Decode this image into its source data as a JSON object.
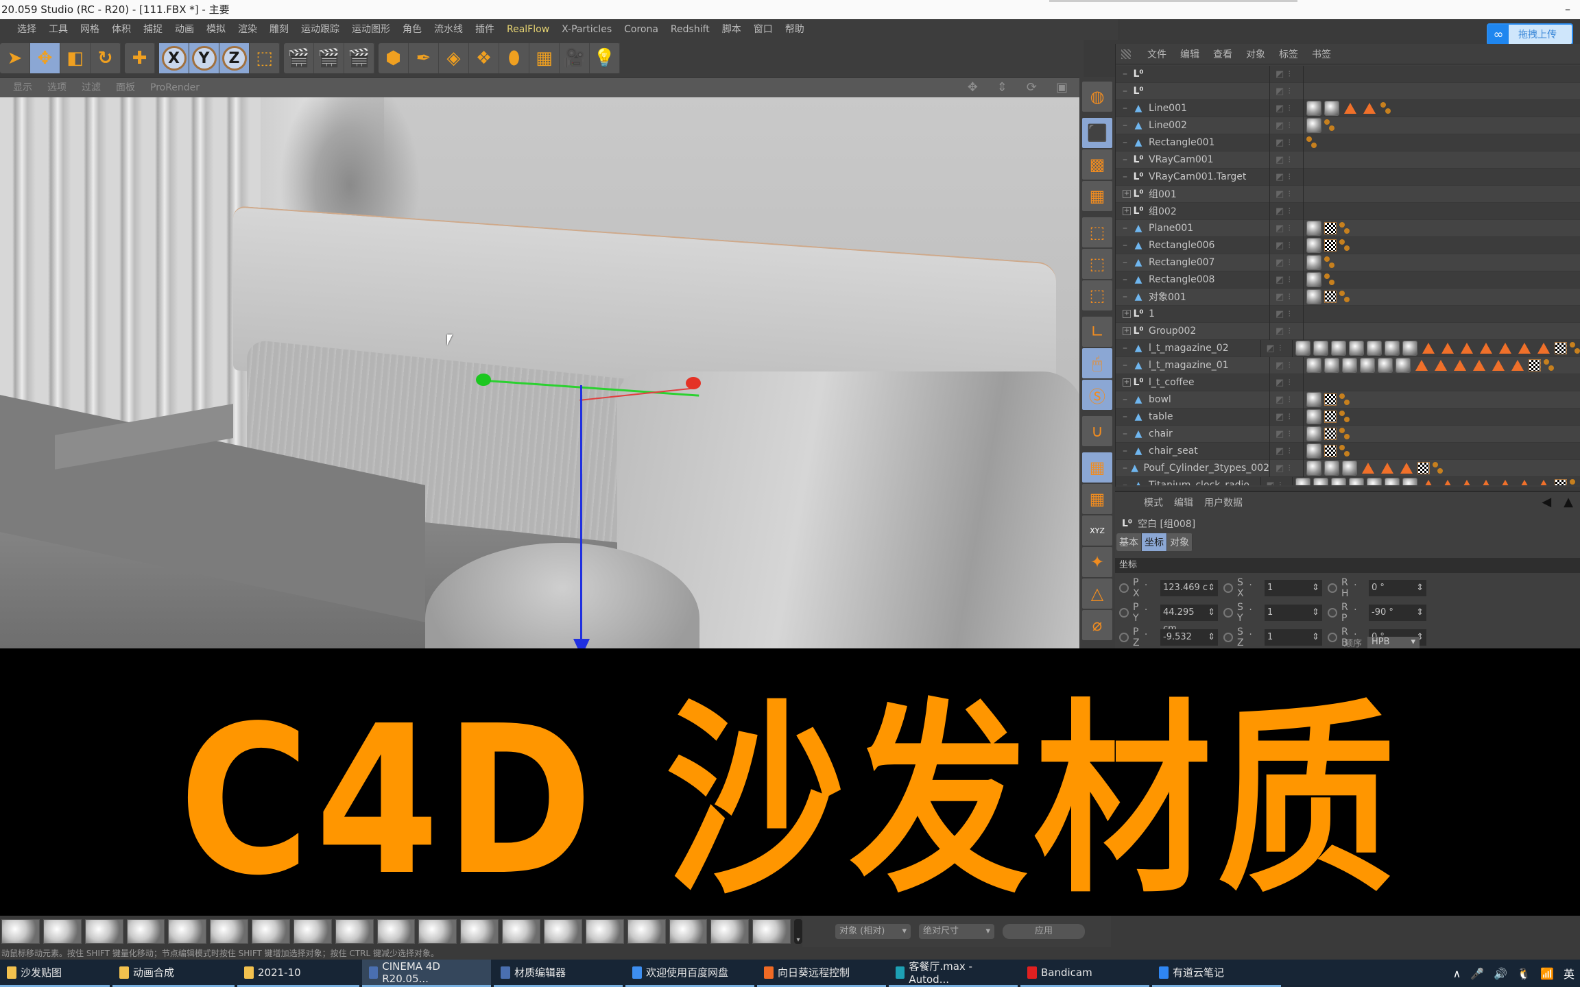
{
  "window": {
    "title": "20.059 Studio (RC - R20) - [111.FBX *] - 主要",
    "minimize_icon": "–"
  },
  "menubar": {
    "items": [
      "选择",
      "工具",
      "网格",
      "体积",
      "捕捉",
      "动画",
      "模拟",
      "渲染",
      "雕刻",
      "运动跟踪",
      "运动图形",
      "角色",
      "流水线",
      "插件",
      "RealFlow",
      "X-Particles",
      "Corona",
      "Redshift",
      "脚本",
      "窗口",
      "帮助"
    ],
    "highlight": "RealFlow"
  },
  "upload_widget": {
    "label": "拖拽上传",
    "icon": "baidu-cloud-icon"
  },
  "toolbar": {
    "groups": [
      [
        {
          "icon": "select-arrow-icon",
          "glyph": "➤",
          "on": false
        },
        {
          "icon": "move-icon",
          "glyph": "✥",
          "on": true
        },
        {
          "icon": "scale-icon",
          "glyph": "◧",
          "on": false
        },
        {
          "icon": "rotate-icon",
          "glyph": "↻",
          "on": false
        }
      ],
      [
        {
          "icon": "live-selection-icon",
          "glyph": "✚",
          "on": false
        }
      ],
      [
        {
          "icon": "x-axis-lock-icon",
          "glyph": "X",
          "on": true,
          "circle": true
        },
        {
          "icon": "y-axis-lock-icon",
          "glyph": "Y",
          "on": true,
          "circle": true
        },
        {
          "icon": "z-axis-lock-icon",
          "glyph": "Z",
          "on": true,
          "circle": true
        },
        {
          "icon": "coordinate-system-icon",
          "glyph": "⬚",
          "on": false
        }
      ],
      [
        {
          "icon": "render-view-icon",
          "glyph": "🎬",
          "on": false
        },
        {
          "icon": "render-picture-viewer-icon",
          "glyph": "🎬",
          "on": false
        },
        {
          "icon": "render-settings-icon",
          "glyph": "🎬",
          "on": false
        }
      ],
      [
        {
          "icon": "cube-icon",
          "glyph": "⬢",
          "on": false
        },
        {
          "icon": "pen-spline-icon",
          "glyph": "✒",
          "on": false
        },
        {
          "icon": "subdivision-icon",
          "glyph": "◈",
          "on": false
        },
        {
          "icon": "cloner-icon",
          "glyph": "❖",
          "on": false
        },
        {
          "icon": "deformer-icon",
          "glyph": "⬮",
          "on": false
        },
        {
          "icon": "floor-icon",
          "glyph": "▦",
          "on": false
        },
        {
          "icon": "camera-icon",
          "glyph": "🎥",
          "on": false
        },
        {
          "icon": "light-icon",
          "glyph": "💡",
          "on": false
        }
      ]
    ]
  },
  "viewport": {
    "menu": [
      "显示",
      "选项",
      "过滤",
      "面板",
      "ProRender"
    ],
    "nav_icons": [
      {
        "icon": "pan-icon",
        "glyph": "✥"
      },
      {
        "icon": "dolly-icon",
        "glyph": "⇕"
      },
      {
        "icon": "orbit-icon",
        "glyph": "⟳"
      },
      {
        "icon": "maximize-view-icon",
        "glyph": "▣"
      }
    ]
  },
  "side_tools": [
    {
      "icon": "make-editable-icon",
      "glyph": "◍",
      "on": false
    },
    {
      "icon": "model-mode-icon",
      "glyph": "⬛",
      "on": true,
      "gap": true
    },
    {
      "icon": "texture-mode-icon",
      "glyph": "▩",
      "on": false
    },
    {
      "icon": "workplane-mode-icon",
      "glyph": "▦",
      "on": false
    },
    {
      "icon": "points-mode-icon",
      "glyph": "⬚",
      "on": false,
      "gap": true
    },
    {
      "icon": "edges-mode-icon",
      "glyph": "⬚",
      "on": false
    },
    {
      "icon": "polygons-mode-icon",
      "glyph": "⬚",
      "on": false
    },
    {
      "icon": "axis-mode-icon",
      "glyph": "∟",
      "on": false,
      "gap": true
    },
    {
      "icon": "tweak-mode-icon",
      "glyph": "🖱",
      "on": true
    },
    {
      "icon": "solo-icon",
      "glyph": "Ⓢ",
      "on": true
    },
    {
      "icon": "snap-icon",
      "glyph": "∪",
      "on": false,
      "gap": true
    },
    {
      "icon": "workplane-lock-icon",
      "glyph": "▦",
      "on": true,
      "gap": true
    },
    {
      "icon": "workplane-align-icon",
      "glyph": "▦",
      "on": false
    },
    {
      "icon": "locked-axes-icon",
      "glyph": "XYZ",
      "on": false
    },
    {
      "icon": "center-axis-icon",
      "glyph": "✦",
      "on": false
    },
    {
      "icon": "symmetry-icon",
      "glyph": "△",
      "on": false
    },
    {
      "icon": "sculpt-icon",
      "glyph": "⌀",
      "on": false
    }
  ],
  "object_manager": {
    "menu": [
      "文件",
      "编辑",
      "查看",
      "对象",
      "标签",
      "书签"
    ],
    "rows": [
      {
        "name": "",
        "type": "null",
        "expand": false,
        "tags": []
      },
      {
        "name": "",
        "type": "null",
        "expand": false,
        "tags": []
      },
      {
        "name": "Line001",
        "type": "poly",
        "expand": false,
        "tags": [
          "mat",
          "mat",
          "tri",
          "tri",
          "uv"
        ]
      },
      {
        "name": "Line002",
        "type": "poly",
        "expand": false,
        "tags": [
          "mat",
          "uv"
        ]
      },
      {
        "name": "Rectangle001",
        "type": "poly",
        "expand": false,
        "tags": [
          "uv"
        ]
      },
      {
        "name": "VRayCam001",
        "type": "null",
        "expand": false,
        "tags": []
      },
      {
        "name": "VRayCam001.Target",
        "type": "null",
        "expand": false,
        "tags": []
      },
      {
        "name": "组001",
        "type": "null",
        "expand": true,
        "tags": []
      },
      {
        "name": "组002",
        "type": "null",
        "expand": true,
        "tags": []
      },
      {
        "name": "Plane001",
        "type": "poly",
        "expand": false,
        "tags": [
          "mat",
          "chk",
          "uv"
        ]
      },
      {
        "name": "Rectangle006",
        "type": "poly",
        "expand": false,
        "tags": [
          "mat",
          "chk",
          "uv"
        ]
      },
      {
        "name": "Rectangle007",
        "type": "poly",
        "expand": false,
        "tags": [
          "mat",
          "uv"
        ]
      },
      {
        "name": "Rectangle008",
        "type": "poly",
        "expand": false,
        "tags": [
          "mat",
          "uv"
        ]
      },
      {
        "name": "对象001",
        "type": "poly",
        "expand": false,
        "tags": [
          "mat",
          "chk",
          "uv"
        ]
      },
      {
        "name": "1",
        "type": "null",
        "expand": true,
        "tags": []
      },
      {
        "name": "Group002",
        "type": "null",
        "expand": true,
        "tags": []
      },
      {
        "name": "l_t_magazine_02",
        "type": "poly",
        "expand": false,
        "tags": [
          "mat",
          "mat",
          "mat",
          "mat",
          "mat",
          "mat",
          "mat",
          "tri",
          "tri",
          "tri",
          "tri",
          "tri",
          "tri",
          "tri",
          "chk",
          "uv"
        ]
      },
      {
        "name": "l_t_magazine_01",
        "type": "poly",
        "expand": false,
        "tags": [
          "mat",
          "mat",
          "mat",
          "mat",
          "mat",
          "mat",
          "tri",
          "tri",
          "tri",
          "tri",
          "tri",
          "tri",
          "chk",
          "uv"
        ]
      },
      {
        "name": "l_t_coffee",
        "type": "null",
        "expand": true,
        "tags": []
      },
      {
        "name": "bowl",
        "type": "poly",
        "expand": false,
        "tags": [
          "mat",
          "chk",
          "uv"
        ]
      },
      {
        "name": "table",
        "type": "poly",
        "expand": false,
        "tags": [
          "mat",
          "chk",
          "uv"
        ]
      },
      {
        "name": "chair",
        "type": "poly",
        "expand": false,
        "tags": [
          "mat",
          "chk",
          "uv"
        ]
      },
      {
        "name": "chair_seat",
        "type": "poly",
        "expand": false,
        "tags": [
          "mat",
          "chk",
          "uv"
        ]
      },
      {
        "name": "Pouf_Cylinder_3types_002",
        "type": "poly",
        "expand": false,
        "tags": [
          "mat",
          "mat",
          "mat",
          "tri",
          "tri",
          "tri",
          "chk",
          "uv"
        ]
      },
      {
        "name": "Titanium_clock_radio",
        "type": "poly",
        "expand": false,
        "tags": [
          "mat",
          "mat",
          "mat",
          "mat",
          "mat",
          "mat",
          "mat",
          "tri",
          "tri",
          "tri",
          "tri",
          "tri",
          "tri",
          "tri",
          "chk",
          "uv"
        ]
      }
    ]
  },
  "attributes": {
    "menu": [
      "模式",
      "编辑",
      "用户数据"
    ],
    "object_title": "空白 [组008]",
    "tabs": [
      {
        "label": "基本",
        "on": false
      },
      {
        "label": "坐标",
        "on": true
      },
      {
        "label": "对象",
        "on": false
      }
    ],
    "section": "坐标",
    "fields": [
      {
        "label": "P . X",
        "value": "123.469 c"
      },
      {
        "label": "S . X",
        "value": "1"
      },
      {
        "label": "R . H",
        "value": "0 °"
      },
      {
        "label": "P . Y",
        "value": "44.295 cm"
      },
      {
        "label": "S . Y",
        "value": "1"
      },
      {
        "label": "R . P",
        "value": "-90 °"
      },
      {
        "label": "P . Z",
        "value": "-9.532 cm"
      },
      {
        "label": "S . Z",
        "value": "1"
      },
      {
        "label": "R . B",
        "value": "0 °"
      }
    ],
    "order_label": "顺序",
    "order_value": "HPB"
  },
  "banner": {
    "text": "C4D 沙发材质",
    "color": "#ff9600"
  },
  "material_bar": {
    "count": 19
  },
  "coord_manager": {
    "mode": "对象 (相对)",
    "size": "绝对尺寸",
    "apply": "应用"
  },
  "status_text": "动鼠标移动元素。按住 SHIFT 键量化移动；节点编辑模式时按住 SHIFT 键增加选择对象；按住 CTRL 键减少选择对象。",
  "taskbar": {
    "tasks": [
      {
        "label": "沙发贴图",
        "icon": "folder-icon",
        "color": "#f2c14e",
        "active": false
      },
      {
        "label": "动画合成",
        "icon": "folder-icon",
        "color": "#f2c14e",
        "active": false
      },
      {
        "label": "2021-10",
        "icon": "folder-icon",
        "color": "#f2c14e",
        "active": false
      },
      {
        "label": "CINEMA 4D R20.05...",
        "icon": "cinema4d-icon",
        "color": "#4a6fb0",
        "active": true
      },
      {
        "label": "材质编辑器",
        "icon": "cinema4d-icon",
        "color": "#4a6fb0",
        "active": false
      },
      {
        "label": "欢迎使用百度网盘",
        "icon": "baidu-netdisk-icon",
        "color": "#3d8ef0",
        "active": false
      },
      {
        "label": "向日葵远程控制",
        "icon": "sunlogin-icon",
        "color": "#f06a24",
        "active": false
      },
      {
        "label": "客餐厅.max - Autod...",
        "icon": "3dsmax-icon",
        "color": "#1da0b4",
        "active": false
      },
      {
        "label": "Bandicam",
        "icon": "bandicam-icon",
        "color": "#e02020",
        "active": false
      },
      {
        "label": "有道云笔记",
        "icon": "youdao-note-icon",
        "color": "#2f86f2",
        "active": false
      }
    ],
    "tray": [
      {
        "icon": "chevron-up-icon",
        "glyph": "∧"
      },
      {
        "icon": "microphone-icon",
        "glyph": "🎤"
      },
      {
        "icon": "speaker-icon",
        "glyph": "🔊"
      },
      {
        "icon": "qq-icon",
        "glyph": "🐧"
      },
      {
        "icon": "wifi-icon",
        "glyph": "📶"
      },
      {
        "icon": "ime-indicator",
        "glyph": "英"
      }
    ]
  }
}
